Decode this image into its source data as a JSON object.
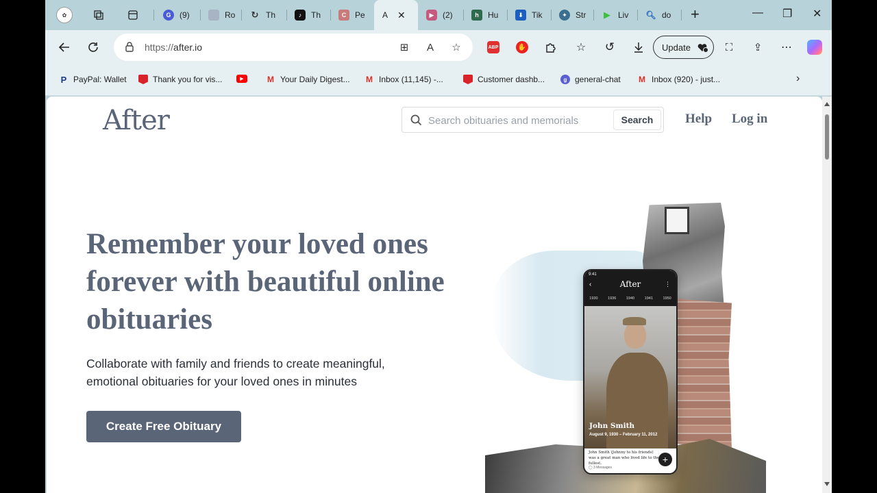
{
  "browser": {
    "tabs": [
      {
        "label": "(9)",
        "favicon": "google-g"
      },
      {
        "label": "Ro",
        "favicon": "after-logo"
      },
      {
        "label": "Th",
        "favicon": "refresh-icon"
      },
      {
        "label": "Th",
        "favicon": "tiktok-icon"
      },
      {
        "label": "Pe",
        "favicon": "c-icon"
      },
      {
        "label": "A",
        "favicon": "after-logo",
        "active": true
      },
      {
        "label": "(2)",
        "favicon": "youtube-icon"
      },
      {
        "label": "Hu",
        "favicon": "h-icon"
      },
      {
        "label": "Tik",
        "favicon": "download-icon"
      },
      {
        "label": "Str",
        "favicon": "str-icon"
      },
      {
        "label": "Liv",
        "favicon": "play-icon"
      },
      {
        "label": "do",
        "favicon": "search-icon"
      }
    ],
    "address": {
      "scheme": "https://",
      "host": "after.io"
    },
    "update_label": "Update",
    "abp_label": "ABP",
    "bookmarks": [
      {
        "label": "PayPal: Wallet",
        "color": "#1f3b8a",
        "glyph": "P"
      },
      {
        "label": "Thank you for vis...",
        "color": "#d9232a",
        "glyph": ""
      },
      {
        "label": "",
        "color": "#ff0000",
        "glyph": "▶"
      },
      {
        "label": "Your Daily Digest...",
        "color": "#d93025",
        "glyph": "M"
      },
      {
        "label": "Inbox (11,145) -...",
        "color": "#d93025",
        "glyph": "M"
      },
      {
        "label": "Customer dashb...",
        "color": "#d9232a",
        "glyph": ""
      },
      {
        "label": "general-chat",
        "color": "#5a5fd1",
        "glyph": "g"
      },
      {
        "label": "Inbox (920) - just...",
        "color": "#d93025",
        "glyph": "M"
      }
    ]
  },
  "site": {
    "logo": "After",
    "search_placeholder": "Search obituaries and memorials",
    "search_button": "Search",
    "nav": {
      "help": "Help",
      "login": "Log in"
    },
    "hero": {
      "title": "Remember your loved ones forever with beautiful online obituaries",
      "subtitle": "Collaborate with family and friends to create meaningful, emotional obituaries for your loved ones in minutes",
      "cta": "Create Free Obituary"
    },
    "phone": {
      "time": "9:41",
      "logo": "After",
      "years": [
        "1930",
        "1936",
        "1940",
        "1941",
        "1950"
      ],
      "name": "John Smith",
      "dates": "August 9, 1930 – February 11, 2012",
      "text": "John Smith (Johnny to his friends) was a great man who lived life to the fullest.",
      "messages": "3 Messages"
    }
  },
  "colors": {
    "brand_slate": "#5a6578",
    "chrome": "#b7d3d9",
    "toolbar": "#e6eff1"
  }
}
